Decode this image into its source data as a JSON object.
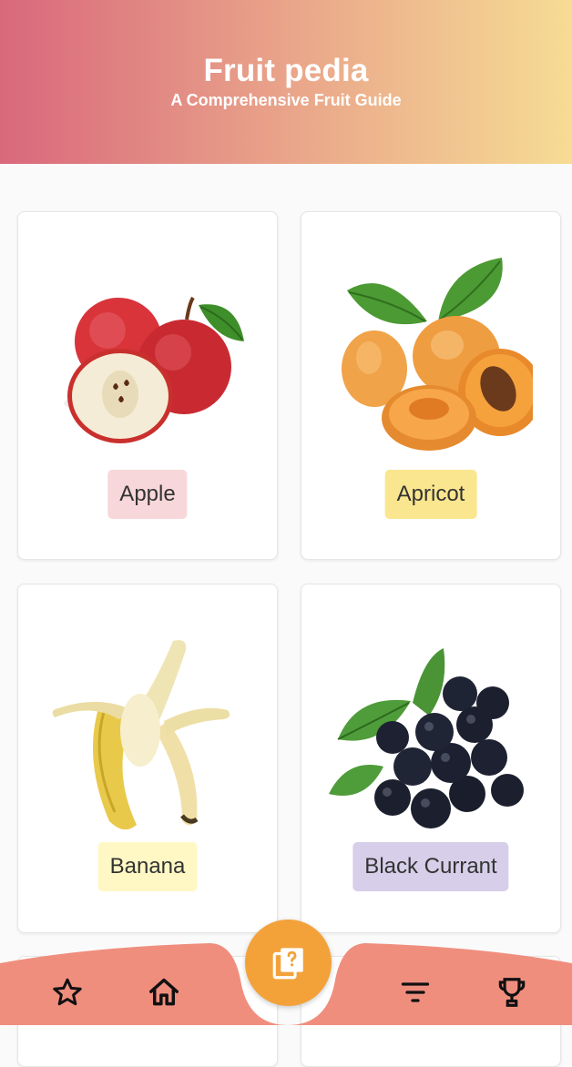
{
  "header": {
    "title": "Fruit pedia",
    "subtitle": "A Comprehensive Fruit Guide"
  },
  "fruits": [
    {
      "name": "Apple",
      "tag_color": "#f8d7da",
      "icon": "apple-image"
    },
    {
      "name": "Apricot",
      "tag_color": "#fae68e",
      "icon": "apricot-image"
    },
    {
      "name": "Banana",
      "tag_color": "#fff8c4",
      "icon": "banana-image"
    },
    {
      "name": "Black Currant",
      "tag_color": "#d7cfe9",
      "icon": "black-currant-image"
    }
  ],
  "bottom_nav": {
    "bar_color": "#f08e7e",
    "fab_color": "#f3a23a",
    "items": [
      {
        "icon": "star-icon"
      },
      {
        "icon": "home-icon"
      },
      {
        "icon": "quiz-icon"
      },
      {
        "icon": "filter-icon"
      },
      {
        "icon": "trophy-icon"
      }
    ]
  }
}
